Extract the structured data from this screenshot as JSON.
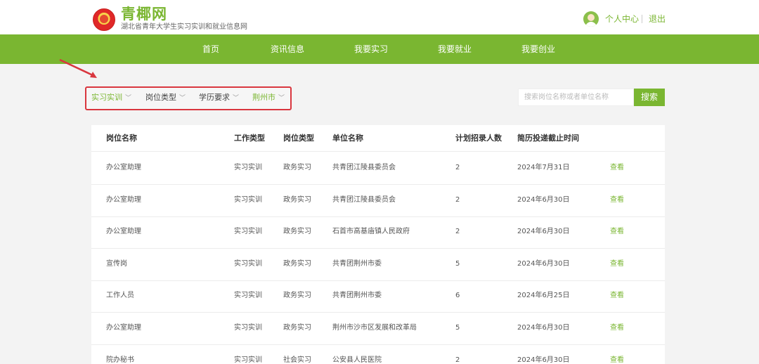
{
  "header": {
    "site_title": "青椰网",
    "site_subtitle": "湖北省青年大学生实习实训和就业信息网",
    "user_center": "个人中心",
    "logout": "退出"
  },
  "nav": {
    "items": [
      "首页",
      "资讯信息",
      "我要实习",
      "我要就业",
      "我要创业"
    ]
  },
  "filters": {
    "items": [
      {
        "label": "实习实训",
        "active": true
      },
      {
        "label": "岗位类型",
        "active": false
      },
      {
        "label": "学历要求",
        "active": false
      },
      {
        "label": "荆州市",
        "active": true
      }
    ]
  },
  "search": {
    "placeholder": "搜索岗位名称或者单位名称",
    "button": "搜索"
  },
  "table": {
    "headers": [
      "岗位名称",
      "工作类型",
      "岗位类型",
      "单位名称",
      "计划招录人数",
      "简历投递截止时间"
    ],
    "rows": [
      [
        "办公室助理",
        "实习实训",
        "政务实习",
        "共青团江陵县委员会",
        "2",
        "2024年7月31日",
        "查看"
      ],
      [
        "办公室助理",
        "实习实训",
        "政务实习",
        "共青团江陵县委员会",
        "2",
        "2024年6月30日",
        "查看"
      ],
      [
        "办公室助理",
        "实习实训",
        "政务实习",
        "石首市高基庙镇人民政府",
        "2",
        "2024年6月30日",
        "查看"
      ],
      [
        "宣传岗",
        "实习实训",
        "政务实习",
        "共青团荆州市委",
        "5",
        "2024年6月30日",
        "查看"
      ],
      [
        "工作人员",
        "实习实训",
        "政务实习",
        "共青团荆州市委",
        "6",
        "2024年6月25日",
        "查看"
      ],
      [
        "办公室助理",
        "实习实训",
        "政务实习",
        "荆州市沙市区发展和改革局",
        "5",
        "2024年6月30日",
        "查看"
      ],
      [
        "院办秘书",
        "实习实训",
        "社会实习",
        "公安县人民医院",
        "2",
        "2024年6月30日",
        "查看"
      ]
    ]
  },
  "colors": {
    "accent": "#7ab631",
    "highlight_border": "#d9363e",
    "background": "#f3f3f3"
  }
}
